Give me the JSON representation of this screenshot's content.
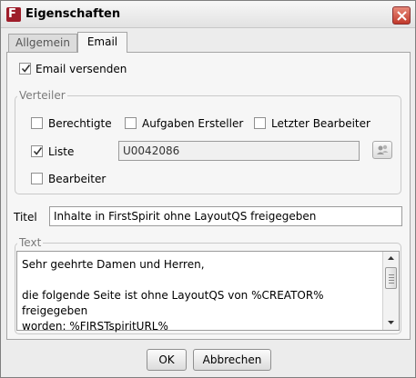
{
  "window": {
    "title": "Eigenschaften",
    "app_icon_letter": "F"
  },
  "tabs": [
    {
      "label": "Allgemein",
      "active": false
    },
    {
      "label": "Email",
      "active": true
    }
  ],
  "email": {
    "send_email_label": "Email versenden",
    "send_email_checked": true,
    "verteiler": {
      "legend": "Verteiler",
      "berechtigte": {
        "label": "Berechtigte",
        "checked": false
      },
      "aufgaben_ersteller": {
        "label": "Aufgaben Ersteller",
        "checked": false
      },
      "letzter_bearbeiter": {
        "label": "Letzter Bearbeiter",
        "checked": false
      },
      "liste": {
        "label": "Liste",
        "checked": true,
        "value": "U0042086"
      },
      "bearbeiter": {
        "label": "Bearbeiter",
        "checked": false
      }
    },
    "titel": {
      "label": "Titel",
      "value": "Inhalte in FirstSpirit ohne LayoutQS freigegeben"
    },
    "text": {
      "legend": "Text",
      "line1": "Sehr geehrte Damen und Herren,",
      "line2": "die folgende Seite ist ohne LayoutQS von %CREATOR% freigegeben",
      "line3": "worden: %FIRSTspiritURL%"
    }
  },
  "buttons": {
    "ok": "OK",
    "cancel": "Abbrechen"
  },
  "colors": {
    "accent": "#9e1d2a",
    "close": "#c0392b"
  }
}
